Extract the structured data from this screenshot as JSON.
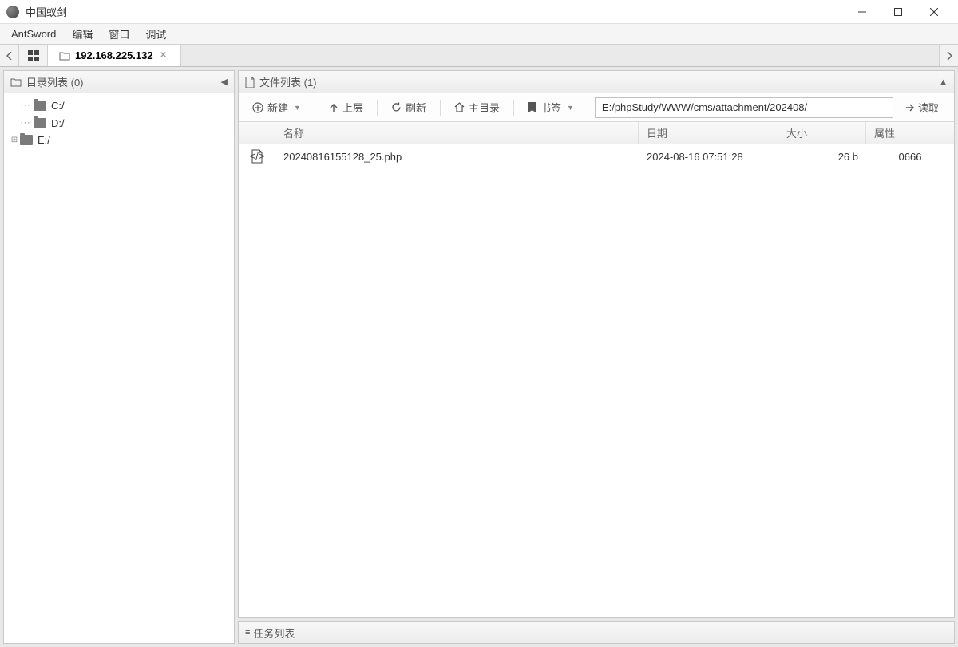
{
  "window": {
    "title": "中国蚁剑"
  },
  "menubar": {
    "brand": "AntSword",
    "items": [
      "编辑",
      "窗口",
      "调试"
    ]
  },
  "tabs": {
    "active_label": "192.168.225.132"
  },
  "sidebar": {
    "title": "目录列表 (0)",
    "items": [
      {
        "label": "C:/",
        "expandable": false
      },
      {
        "label": "D:/",
        "expandable": false
      },
      {
        "label": "E:/",
        "expandable": true
      }
    ]
  },
  "filepanel": {
    "title": "文件列表 (1)",
    "toolbar": {
      "new": "新建",
      "up": "上层",
      "refresh": "刷新",
      "home": "主目录",
      "bookmark": "书签",
      "path": "E:/phpStudy/WWW/cms/attachment/202408/",
      "read": "读取"
    },
    "columns": {
      "name": "名称",
      "date": "日期",
      "size": "大小",
      "attr": "属性"
    },
    "rows": [
      {
        "name": "20240816155128_25.php",
        "date": "2024-08-16 07:51:28",
        "size": "26 b",
        "attr": "0666"
      }
    ]
  },
  "taskpanel": {
    "title": "任务列表"
  }
}
